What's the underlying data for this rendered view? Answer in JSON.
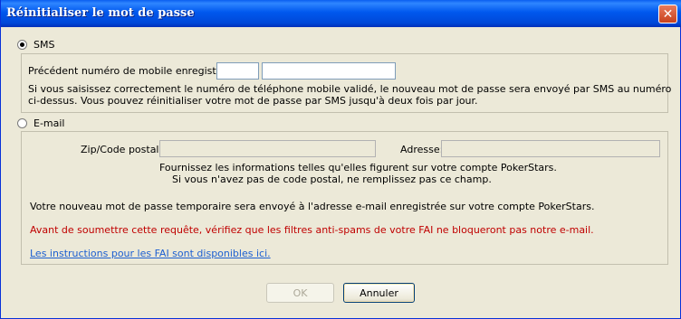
{
  "window": {
    "title": "Réinitialiser le mot de passe"
  },
  "sms": {
    "option_label": "SMS",
    "selected": true,
    "phone_label": "Précédent numéro de mobile enregistré:",
    "phone_prefix_value": "",
    "phone_number_value": "",
    "info_line1": "Si vous saisissez correctement le numéro de téléphone mobile validé, le nouveau mot de passe sera envoyé par SMS au numéro",
    "info_line2": "ci-dessus. Vous pouvez réinitialiser votre mot de passe par SMS jusqu'à deux fois par jour."
  },
  "email": {
    "option_label": "E-mail",
    "selected": false,
    "zip_label": "Zip/Code postal:",
    "zip_value": "",
    "address_label": "Adresse:",
    "address_value": "",
    "info_line1": "Fournissez les informations telles qu'elles figurent sur votre compte PokerStars.",
    "info_line2": "Si vous n'avez pas de code postal, ne remplissez pas ce champ.",
    "temp_password_notice": "Votre nouveau mot de passe temporaire sera envoyé à l'adresse e-mail enregistrée sur votre compte PokerStars.",
    "spam_warning": "Avant de soumettre cette requête, vérifiez que les filtres anti-spams de votre FAI ne bloqueront pas notre e-mail.",
    "isp_link": "Les instructions pour les FAI sont disponibles ici."
  },
  "buttons": {
    "ok_label": "OK",
    "ok_enabled": false,
    "cancel_label": "Annuler"
  },
  "colors": {
    "warning": "#c00000",
    "link": "#1c5fd1",
    "titlebar": "#0058ee"
  }
}
